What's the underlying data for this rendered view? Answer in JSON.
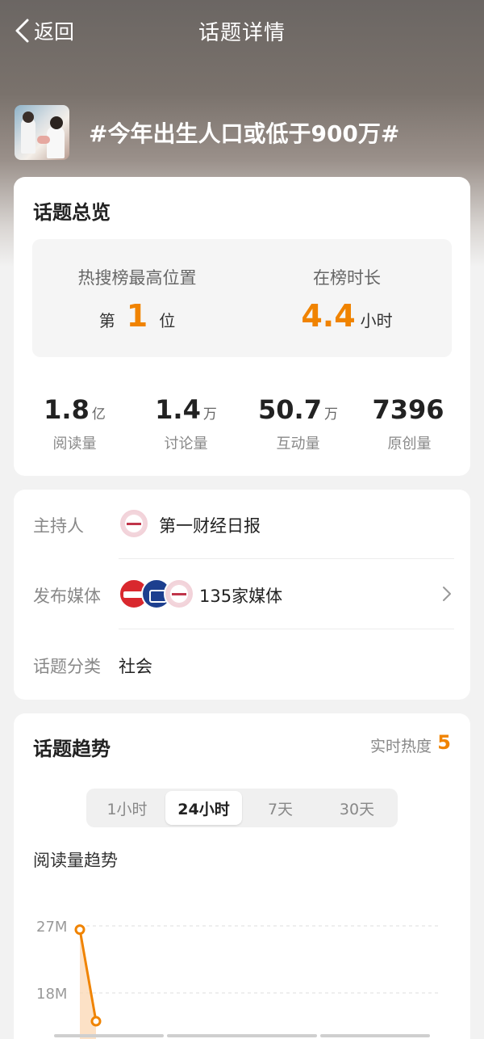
{
  "nav": {
    "back_label": "返回",
    "title": "话题详情"
  },
  "topic": {
    "title": "#今年出生人口或低于900万#"
  },
  "overview": {
    "title": "话题总览",
    "rank_label": "热搜榜最高位置",
    "rank_prefix": "第",
    "rank_value": "1",
    "rank_suffix": "位",
    "duration_label": "在榜时长",
    "duration_value": "4.4",
    "duration_unit": "小时"
  },
  "stats": [
    {
      "value": "1.8",
      "unit": "亿",
      "label": "阅读量"
    },
    {
      "value": "1.4",
      "unit": "万",
      "label": "讨论量"
    },
    {
      "value": "50.7",
      "unit": "万",
      "label": "互动量"
    },
    {
      "value": "7396",
      "unit": "",
      "label": "原创量"
    }
  ],
  "info": {
    "host_label": "主持人",
    "host_value": "第一财经日报",
    "media_label": "发布媒体",
    "media_value": "135家媒体",
    "category_label": "话题分类",
    "category_value": "社会"
  },
  "trend": {
    "title": "话题趋势",
    "heat_label": "实时热度",
    "heat_value": "5",
    "tabs": [
      "1小时",
      "24小时",
      "7天",
      "30天"
    ],
    "active_tab": "24小时",
    "chart_title": "阅读量趋势"
  },
  "chart_data": {
    "type": "line",
    "title": "阅读量趋势",
    "y_ticks": [
      "27M",
      "18M"
    ],
    "y_tick_values": [
      27,
      18
    ],
    "x": [
      0,
      1
    ],
    "series": [
      {
        "values": [
          26.5,
          14.2
        ]
      }
    ],
    "color": "#f08300"
  }
}
